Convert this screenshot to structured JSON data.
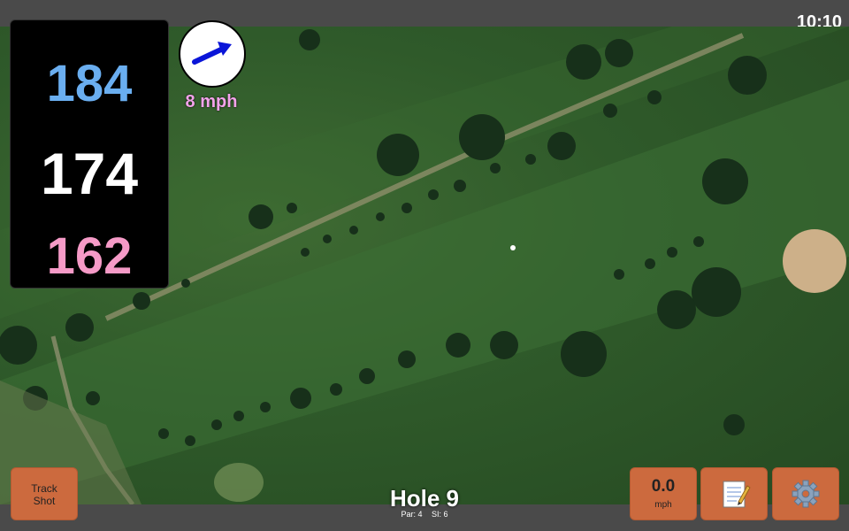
{
  "status": {
    "time": "10:10"
  },
  "distances": {
    "back": "184",
    "center": "174",
    "front": "162"
  },
  "wind": {
    "speed": "8 mph",
    "direction_icon": "wind-arrow-icon"
  },
  "hole": {
    "title": "Hole 9",
    "par": "Par: 4",
    "stroke_index": "SI: 6"
  },
  "buttons": {
    "track_shot_line1": "Track",
    "track_shot_line2": "Shot",
    "speed_value": "0.0",
    "speed_unit": "mph",
    "notes_icon": "notepad-icon",
    "settings_icon": "gear-icon"
  },
  "colors": {
    "back": "#6aaef0",
    "center": "#ffffff",
    "front": "#f59ac7",
    "button": "#cc6a3e",
    "wind_text": "#f3a3ea"
  }
}
